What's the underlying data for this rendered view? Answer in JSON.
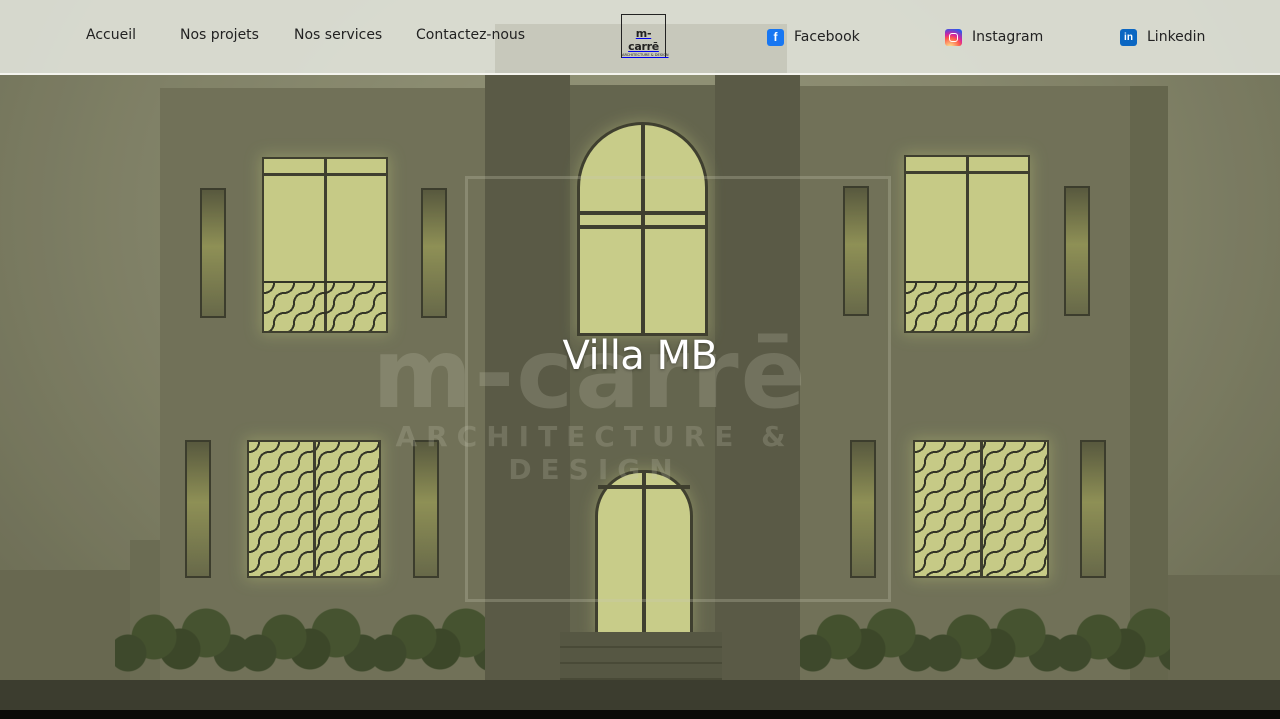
{
  "nav": {
    "items": [
      {
        "label": "Accueil"
      },
      {
        "label": "Nos projets"
      },
      {
        "label": "Nos services"
      },
      {
        "label": "Contactez-nous"
      }
    ]
  },
  "logo": {
    "name": "m-carrē",
    "tagline": "ARCHITECTURE & DESIGN"
  },
  "social": {
    "facebook": {
      "label": "Facebook",
      "icon": "facebook-icon",
      "color": "#1877f2"
    },
    "instagram": {
      "label": "Instagram",
      "icon": "instagram-icon",
      "color": "#d6249f"
    },
    "linkedin": {
      "label": "Linkedin",
      "icon": "linkedin-icon",
      "color": "#0a66c2"
    }
  },
  "hero": {
    "title": "Villa MB",
    "watermark_name": "m-carrē",
    "watermark_tagline": "ARCHITECTURE & DESIGN"
  }
}
